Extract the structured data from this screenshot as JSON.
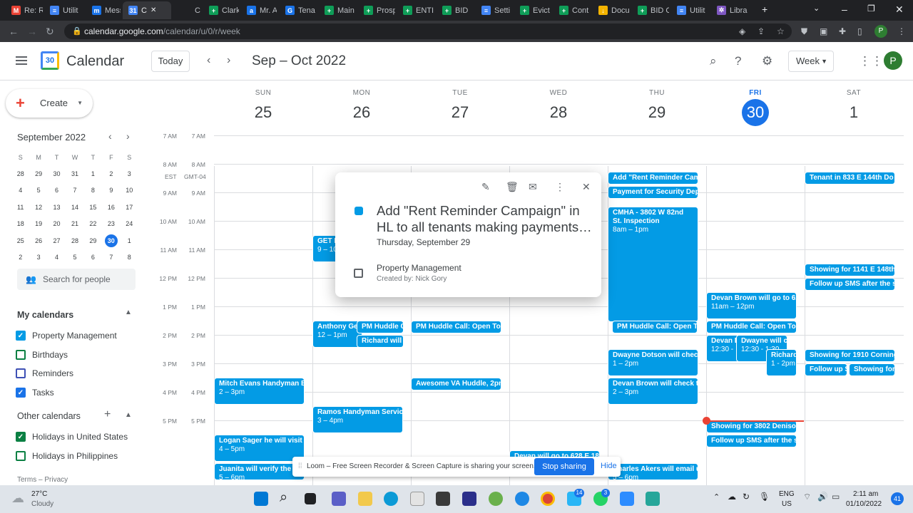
{
  "browser": {
    "tabs": [
      {
        "label": "Re: R",
        "fav": "M",
        "color": "#ea4335"
      },
      {
        "label": "Utilit",
        "fav": "≡",
        "color": "#4285f4"
      },
      {
        "label": "Mess",
        "fav": "m",
        "color": "#1a73e8"
      },
      {
        "label": "C",
        "fav": "31",
        "color": "#4285f4",
        "active": true
      },
      {
        "label": "Clev",
        "fav": "",
        "color": "#202124"
      },
      {
        "label": "Clark",
        "fav": "+",
        "color": "#0f9d58"
      },
      {
        "label": "Mr. A",
        "fav": "a",
        "color": "#1a73e8"
      },
      {
        "label": "Tena",
        "fav": "G",
        "color": "#1a73e8"
      },
      {
        "label": "Main",
        "fav": "+",
        "color": "#0f9d58"
      },
      {
        "label": "Prosp",
        "fav": "+",
        "color": "#0f9d58"
      },
      {
        "label": "ENTI",
        "fav": "+",
        "color": "#0f9d58"
      },
      {
        "label": "BID",
        "fav": "+",
        "color": "#0f9d58"
      },
      {
        "label": "Setti",
        "fav": "≡",
        "color": "#4285f4"
      },
      {
        "label": "Evict",
        "fav": "+",
        "color": "#0f9d58"
      },
      {
        "label": "Cont",
        "fav": "+",
        "color": "#0f9d58"
      },
      {
        "label": "Docu",
        "fav": "↓",
        "color": "#f4b400"
      },
      {
        "label": "BID C",
        "fav": "+",
        "color": "#0f9d58"
      },
      {
        "label": "Utilit",
        "fav": "≡",
        "color": "#4285f4"
      },
      {
        "label": "Libra",
        "fav": "✲",
        "color": "#7e57c2"
      }
    ],
    "url_host": "calendar.google.com",
    "url_path": "/calendar/u/0/r/week",
    "profile": "P"
  },
  "header": {
    "app_name": "Calendar",
    "logo_text": "30",
    "today_label": "Today",
    "date_range": "Sep – Oct 2022",
    "view_label": "Week",
    "avatar": "P"
  },
  "sidebar": {
    "create_label": "Create",
    "mini_month": "September 2022",
    "weekday_initials": [
      "S",
      "M",
      "T",
      "W",
      "T",
      "F",
      "S"
    ],
    "weeks": [
      [
        "28",
        "29",
        "30",
        "31",
        "1",
        "2",
        "3"
      ],
      [
        "4",
        "5",
        "6",
        "7",
        "8",
        "9",
        "10"
      ],
      [
        "11",
        "12",
        "13",
        "14",
        "15",
        "16",
        "17"
      ],
      [
        "18",
        "19",
        "20",
        "21",
        "22",
        "23",
        "24"
      ],
      [
        "25",
        "26",
        "27",
        "28",
        "29",
        "30",
        "1"
      ],
      [
        "2",
        "3",
        "4",
        "5",
        "6",
        "7",
        "8"
      ]
    ],
    "search_people": "Search for people",
    "my_calendars_title": "My calendars",
    "my_calendars": [
      {
        "label": "Property Management",
        "checked": true,
        "color": "#039be5"
      },
      {
        "label": "Birthdays",
        "checked": false,
        "color": "#0b8043"
      },
      {
        "label": "Reminders",
        "checked": false,
        "color": "#3f51b5"
      },
      {
        "label": "Tasks",
        "checked": true,
        "color": "#1a73e8"
      }
    ],
    "other_calendars_title": "Other calendars",
    "other_calendars": [
      {
        "label": "Holidays in United States",
        "checked": true,
        "color": "#0b8043"
      },
      {
        "label": "Holidays in Philippines",
        "checked": false,
        "color": "#0b8043"
      }
    ],
    "footer_terms": "Terms",
    "footer_sep": "–",
    "footer_privacy": "Privacy"
  },
  "week": {
    "days": [
      {
        "name": "SUN",
        "num": "25"
      },
      {
        "name": "MON",
        "num": "26"
      },
      {
        "name": "TUE",
        "num": "27"
      },
      {
        "name": "WED",
        "num": "28"
      },
      {
        "name": "THU",
        "num": "29"
      },
      {
        "name": "FRI",
        "num": "30",
        "current": true
      },
      {
        "name": "SAT",
        "num": "1"
      }
    ],
    "tz_primary": "EST",
    "tz_secondary": "GMT-04",
    "times": [
      "7 AM",
      "8 AM",
      "9 AM",
      "10 AM",
      "11 AM",
      "12 PM",
      "1 PM",
      "2 PM",
      "3 PM",
      "4 PM",
      "5 PM"
    ]
  },
  "events": [
    {
      "title": "Add \"Rent Reminder Cam",
      "time": ""
    },
    {
      "title": "Payment for Security Dep",
      "time": ""
    },
    {
      "title": "Tenant in 833 E 144th Do",
      "time": ""
    },
    {
      "title": "CMHA - 3802 W 82nd St. Inspection",
      "time": "8am – 1pm"
    },
    {
      "title": "GET E",
      "time": "9 – 10"
    },
    {
      "title": "Showing for 1910 Corning",
      "time": ""
    },
    {
      "title": "Follow up SMS after the sh",
      "time": ""
    },
    {
      "title": "Showing for 1141 E 148th",
      "time": ""
    },
    {
      "title": "Follow up SMS after the sh",
      "time": ""
    },
    {
      "title": "Devan Brown will go to 628",
      "time": "11am – 12pm"
    },
    {
      "title": "Anthony Gei",
      "time": "12 – 1pm"
    },
    {
      "title": "PM Huddle C",
      "time": ""
    },
    {
      "title": "Richard will",
      "time": ""
    },
    {
      "title": "PM Huddle Call: Open ToD",
      "time": ""
    },
    {
      "title": "PM Huddle Call: Open To",
      "time": ""
    },
    {
      "title": "PM Huddle Call: Open ToD",
      "time": ""
    },
    {
      "title": "Devan B",
      "time": "12:30 -"
    },
    {
      "title": "Dwayne will ch",
      "time": "12:30 - 1:30"
    },
    {
      "title": "Richard",
      "time": "1 - 2pm"
    },
    {
      "title": "Dwayne Dotson will check",
      "time": "1 – 2pm"
    },
    {
      "title": "Showing for 1910 Corning",
      "time": ""
    },
    {
      "title": "Follow up SM",
      "time": ""
    },
    {
      "title": "Showing for",
      "time": ""
    },
    {
      "title": "Mitch Evans Handyman Bo",
      "time": "2 – 3pm"
    },
    {
      "title": "Awesome VA Huddle, 2pm",
      "time": ""
    },
    {
      "title": "Devan Brown will check the",
      "time": "2 – 3pm"
    },
    {
      "title": "Ramos Handyman Service",
      "time": "3 – 4pm"
    },
    {
      "title": "Showing for 3802 Denison",
      "time": ""
    },
    {
      "title": "Follow up SMS after the sh",
      "time": ""
    },
    {
      "title": "Logan Sager he will visit th",
      "time": "4 – 5pm"
    },
    {
      "title": "Juanita will verify the",
      "time": "5 – 6pm"
    },
    {
      "title": "Devan will go to 628 E 185",
      "time": ""
    },
    {
      "title": "Charles Akers will email us",
      "time": "5 – 6pm"
    }
  ],
  "popup": {
    "title": "Add \"Rent Reminder Campaign\" in HL to all tenants making payments…",
    "date": "Thursday, September 29",
    "calendar": "Property Management",
    "creator": "Created by: Nick Gory"
  },
  "loom": {
    "message": "Loom – Free Screen Recorder & Screen Capture is sharing your screen.",
    "stop_label": "Stop sharing",
    "hide_label": "Hide"
  },
  "taskbar": {
    "temp": "27°C",
    "weather": "Cloudy",
    "lang1": "ENG",
    "lang2": "US",
    "time": "2:11 am",
    "date": "01/10/2022",
    "badge1": "14",
    "badge2": "3",
    "notif": "41"
  }
}
